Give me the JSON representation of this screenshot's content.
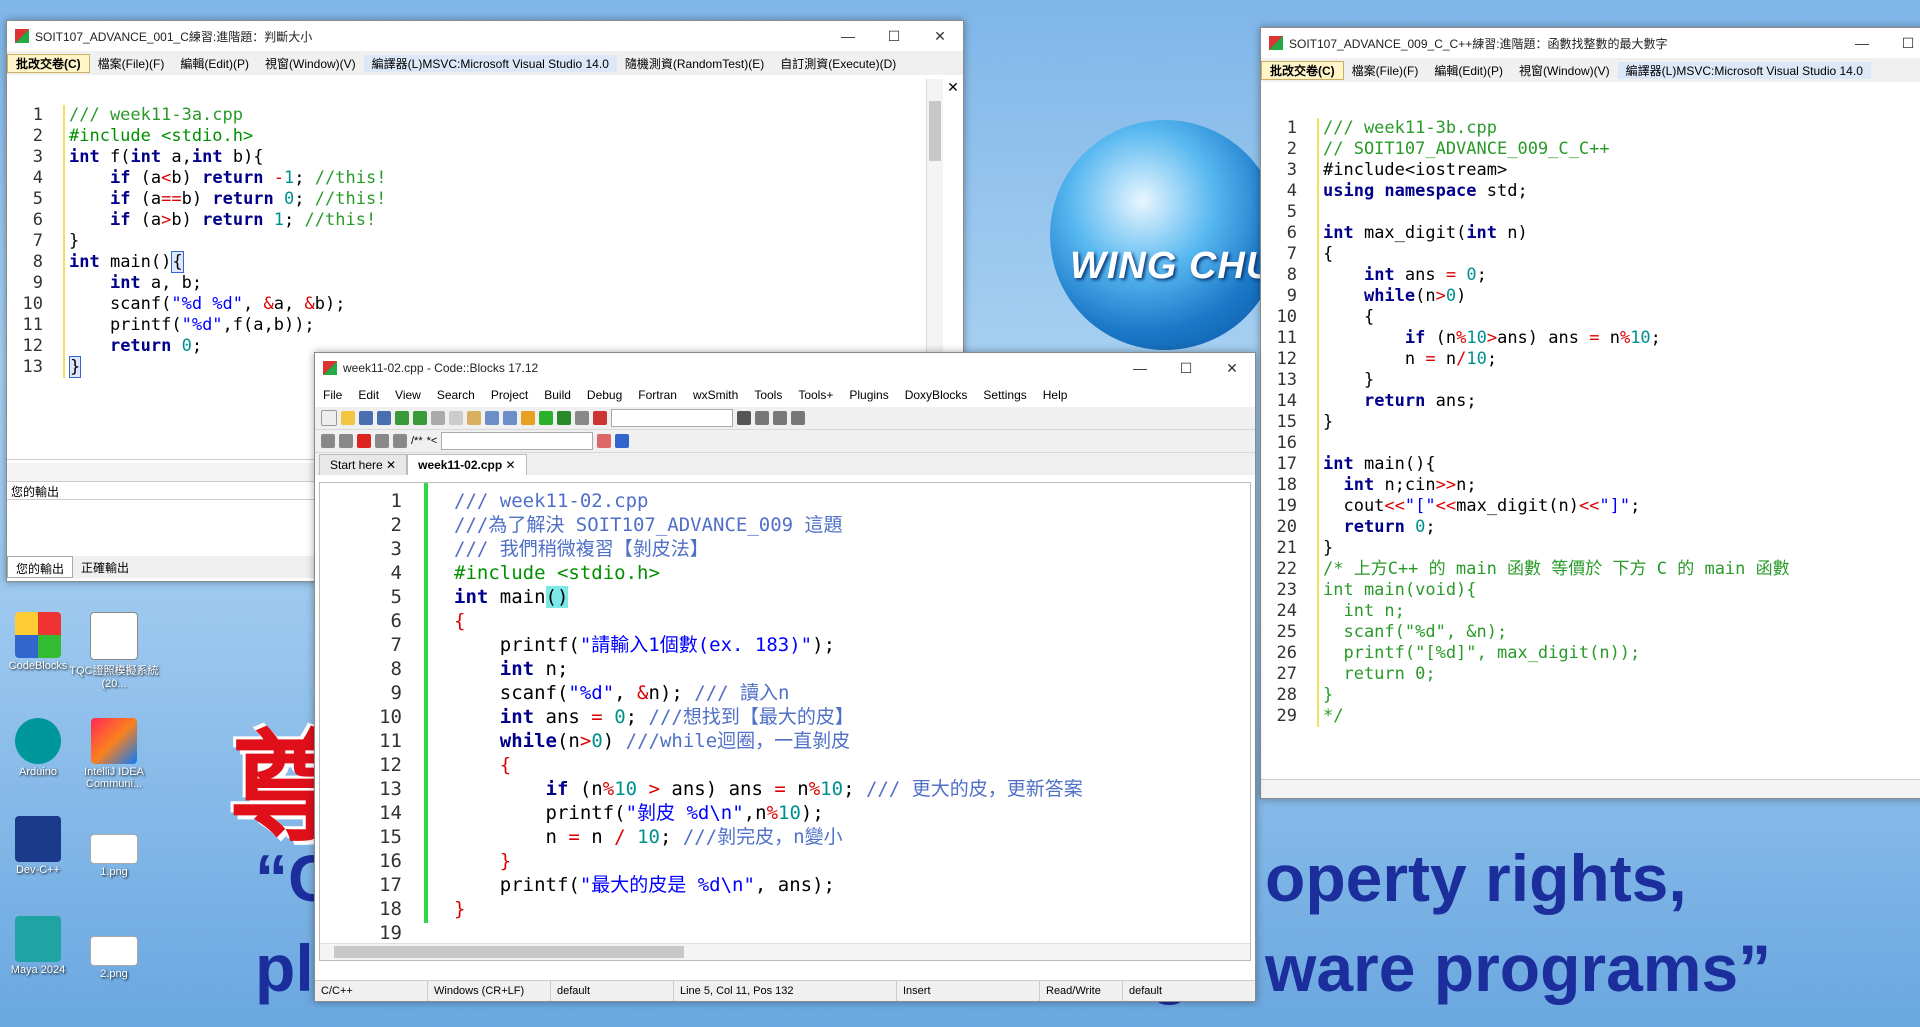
{
  "desktop": {
    "brand": "WING CHUAN",
    "slogan_big": "尊",
    "slogan_line1a": "“C",
    "slogan_line1b": "operty rights,",
    "slogan_line2a": "pl",
    "slogan_line2b": "g",
    "slogan_line2c": "ware programs”",
    "icons": [
      {
        "label": "CodeBlocks"
      },
      {
        "label": "TQC證照模擬系統(20..."
      },
      {
        "label": "Arduino"
      },
      {
        "label": "IntelliJ IDEA Communi..."
      },
      {
        "label": "Dev-C++"
      },
      {
        "label": "1.png"
      },
      {
        "label": "Maya 2024"
      },
      {
        "label": "2.png"
      }
    ]
  },
  "win1": {
    "title": "SOIT107_ADVANCE_001_C練習:進階題：判斷大小",
    "menu": [
      "批改交卷(C)",
      "檔案(File)(F)",
      "編輯(Edit)(P)",
      "視窗(Window)(V)",
      "編譯器(L)MSVC:Microsoft Visual Studio 14.0",
      "隨機測資(RandomTest)(E)",
      "自訂測資(Execute)(D)"
    ],
    "output_label": "您的輸出",
    "tabs": [
      "您的輸出",
      "正確輸出"
    ],
    "lines": [
      "1",
      "2",
      "3",
      "4",
      "5",
      "6",
      "7",
      "8",
      "9",
      "10",
      "11",
      "12",
      "13"
    ]
  },
  "win2": {
    "title": "SOIT107_ADVANCE_009_C_C++練習:進階題：函數找整數的最大數字",
    "menu": [
      "批改交卷(C)",
      "檔案(File)(F)",
      "編輯(Edit)(P)",
      "視窗(Window)(V)",
      "編譯器(L)MSVC:Microsoft Visual Studio 14.0"
    ],
    "lines": [
      "1",
      "2",
      "3",
      "4",
      "5",
      "6",
      "7",
      "8",
      "9",
      "10",
      "11",
      "12",
      "13",
      "14",
      "15",
      "16",
      "17",
      "18",
      "19",
      "20",
      "21",
      "22",
      "23",
      "24",
      "25",
      "26",
      "27",
      "28",
      "29"
    ]
  },
  "cb": {
    "title": "week11-02.cpp - Code::Blocks 17.12",
    "menu": [
      "File",
      "Edit",
      "View",
      "Search",
      "Project",
      "Build",
      "Debug",
      "Fortran",
      "wxSmith",
      "Tools",
      "Tools+",
      "Plugins",
      "DoxyBlocks",
      "Settings",
      "Help"
    ],
    "tabs": [
      "Start here",
      "week11-02.cpp"
    ],
    "lines": [
      "1",
      "2",
      "3",
      "4",
      "5",
      "6",
      "7",
      "8",
      "9",
      "10",
      "11",
      "12",
      "13",
      "14",
      "15",
      "16",
      "17",
      "18",
      "19"
    ],
    "status": [
      "C/C++",
      "Windows (CR+LF)",
      "default",
      "Line 5, Col 11, Pos 132",
      "Insert",
      "Read/Write",
      "default"
    ]
  }
}
